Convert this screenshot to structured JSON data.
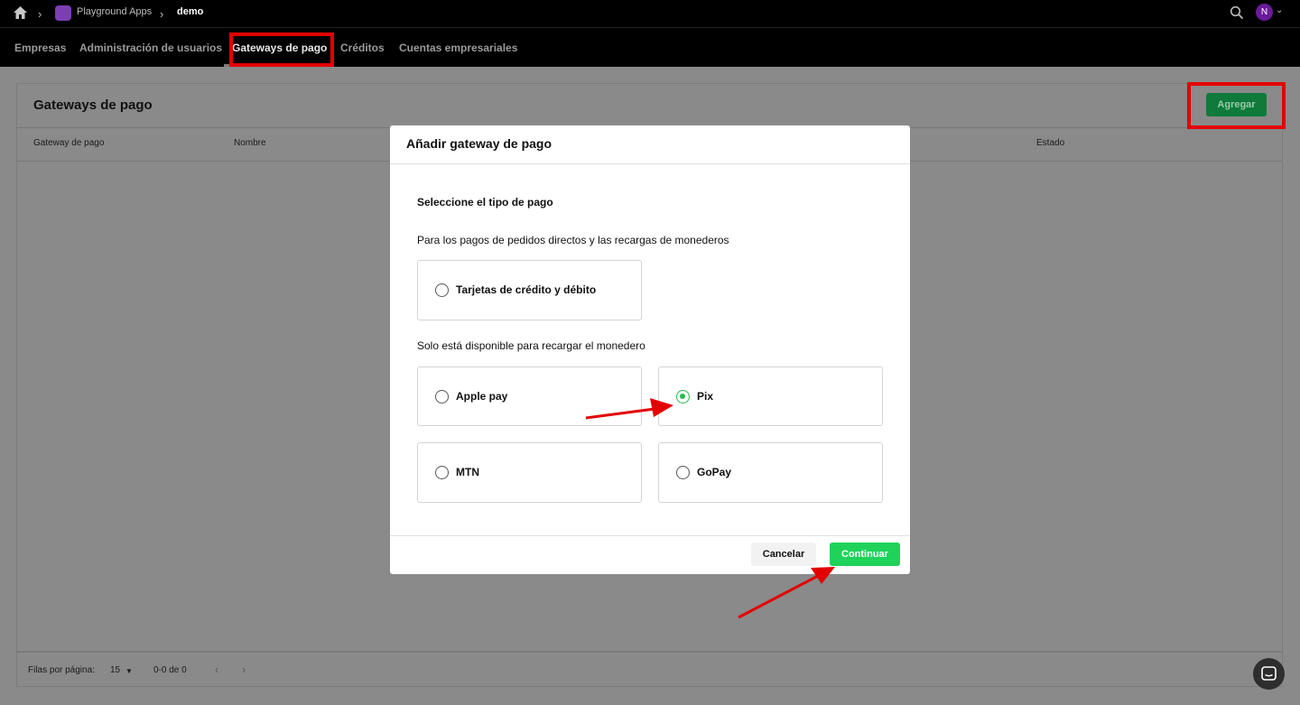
{
  "breadcrumb": {
    "app": "Playground Apps",
    "current": "demo"
  },
  "user": {
    "initial": "N"
  },
  "tabs": [
    {
      "label": "Empresas"
    },
    {
      "label": "Administración de usuarios"
    },
    {
      "label": "Gateways de pago",
      "active": true
    },
    {
      "label": "Créditos"
    },
    {
      "label": "Cuentas empresariales"
    }
  ],
  "page": {
    "title": "Gateways de pago",
    "add_label": "Agregar",
    "columns": [
      "Gateway de pago",
      "Nombre",
      "Estado"
    ],
    "footer": {
      "rows_label": "Filas por página:",
      "rows_value": "15",
      "range": "0-0 de 0"
    }
  },
  "modal": {
    "title": "Añadir gateway de pago",
    "select_label": "Seleccione el tipo de pago",
    "section1": "Para los pagos de pedidos directos y las recargas de monederos",
    "section2": "Solo está disponible para recargar el monedero",
    "options": [
      {
        "label": "Tarjetas de crédito y débito",
        "selected": false
      },
      {
        "label": "Apple pay",
        "selected": false
      },
      {
        "label": "Pix",
        "selected": true
      },
      {
        "label": "MTN",
        "selected": false
      },
      {
        "label": "GoPay",
        "selected": false
      }
    ],
    "cancel_label": "Cancelar",
    "continue_label": "Continuar"
  },
  "colors": {
    "highlight": "#e30000",
    "accent": "#1fd25a",
    "annotation_arrow": "#e30000"
  }
}
